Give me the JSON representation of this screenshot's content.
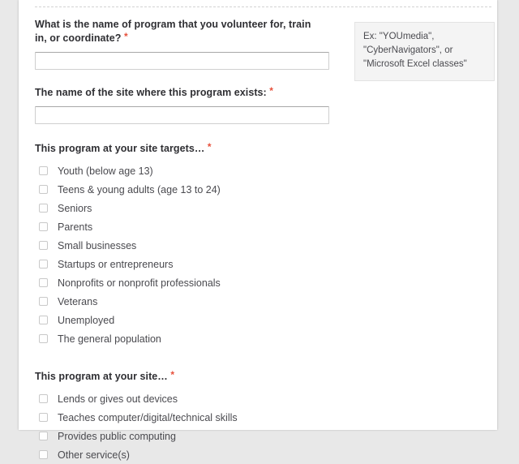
{
  "form": {
    "questions": [
      {
        "id": "program-name",
        "label": "What is the name of program that you volunteer for, train in, or coordinate?",
        "required_marker": "*",
        "input_value": "",
        "input_placeholder": ""
      },
      {
        "id": "site-name",
        "label": "The name of the site where this program exists:",
        "required_marker": "*",
        "input_value": "",
        "input_placeholder": ""
      },
      {
        "id": "program-targets",
        "label": "This program at your site targets…",
        "required_marker": "*",
        "options": [
          "Youth (below age 13)",
          "Teens & young adults (age 13 to 24)",
          "Seniors",
          "Parents",
          "Small businesses",
          "Startups or entrepreneurs",
          "Nonprofits or nonprofit professionals",
          "Veterans",
          "Unemployed",
          "The general population"
        ]
      },
      {
        "id": "program-services",
        "label": "This program at your site…",
        "required_marker": "*",
        "options": [
          "Lends or gives out devices",
          "Teaches computer/digital/technical skills",
          "Provides public computing",
          "Other service(s)"
        ]
      }
    ]
  },
  "help": {
    "text": "Ex: \"YOUmedia\", \"CyberNavigators\", or \"Microsoft Excel classes\""
  },
  "colors": {
    "required_asterisk": "#e7503b",
    "label_text": "#2f2f33",
    "option_text": "#4a4a4f",
    "panel_background": "#ffffff",
    "page_background": "#e9e9e9",
    "help_background": "#f4f4f4"
  }
}
